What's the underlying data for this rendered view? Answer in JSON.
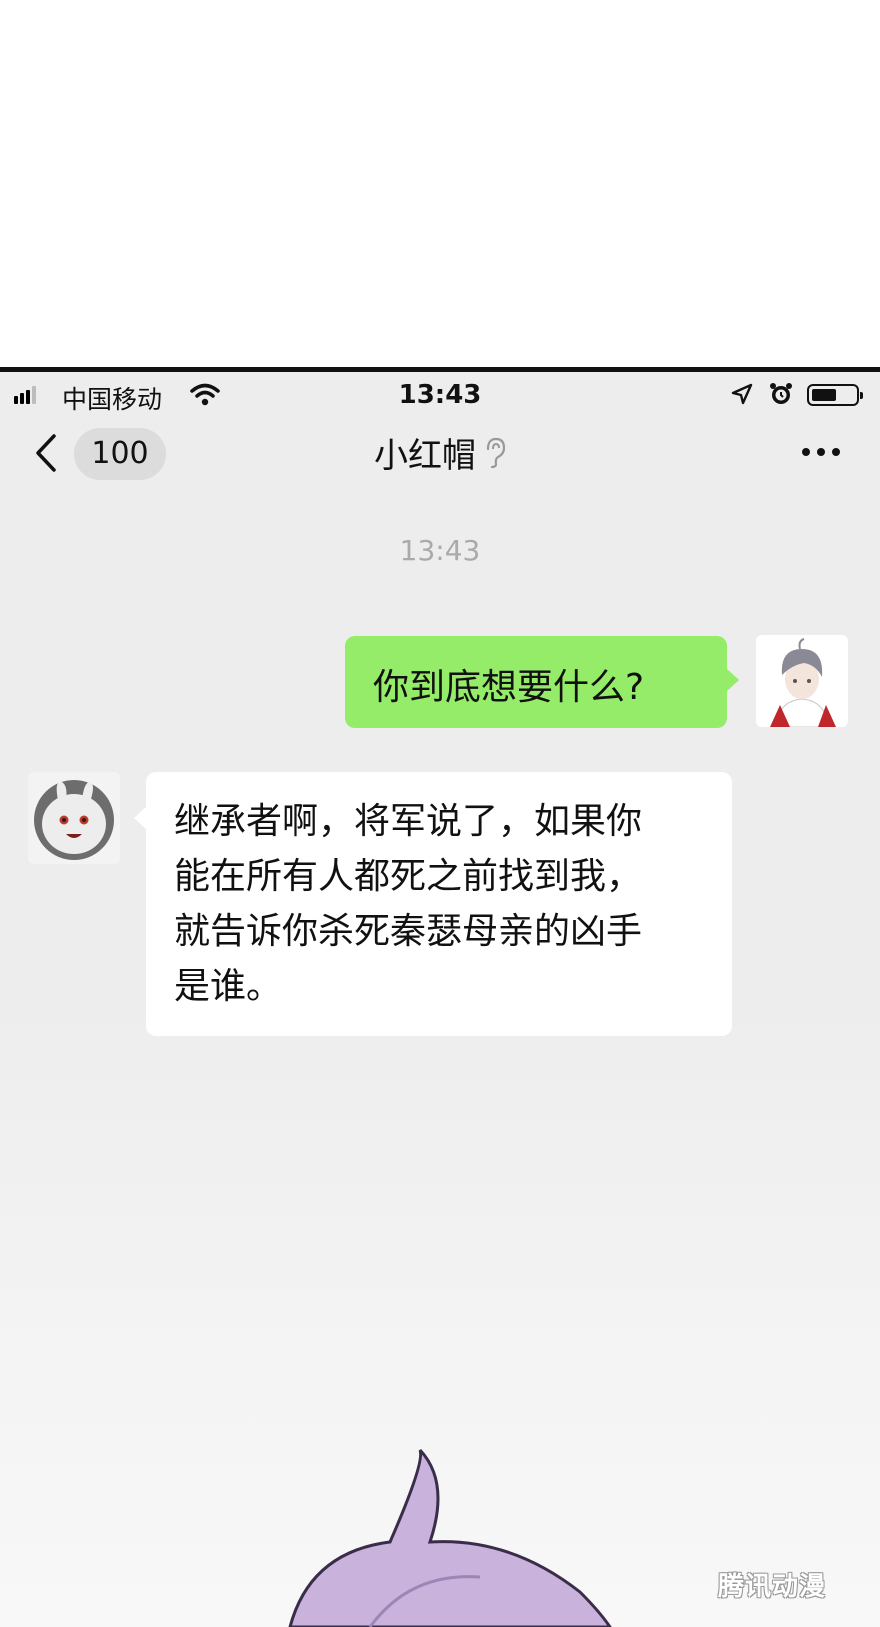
{
  "status_bar": {
    "carrier": "中国移动",
    "time": "13:43"
  },
  "nav": {
    "unread_count": "100",
    "title": "小红帽"
  },
  "chat": {
    "timestamp": "13:43",
    "messages": [
      {
        "sender": "me",
        "text": "你到底想要什么?"
      },
      {
        "sender": "other",
        "lines": [
          "继承者啊，将军说了，如果你",
          "能在所有人都死之前找到我，",
          "就告诉你杀死秦瑟母亲的凶手",
          "是谁。"
        ]
      }
    ]
  },
  "watermark": "腾讯动漫",
  "colors": {
    "chat_background": "#ededed",
    "my_bubble": "#95ec69",
    "other_bubble": "#ffffff"
  },
  "icons": [
    "signal-icon",
    "wifi-icon",
    "location-icon",
    "alarm-icon",
    "battery-icon",
    "back-chevron-icon",
    "ear-icon",
    "more-icon"
  ]
}
